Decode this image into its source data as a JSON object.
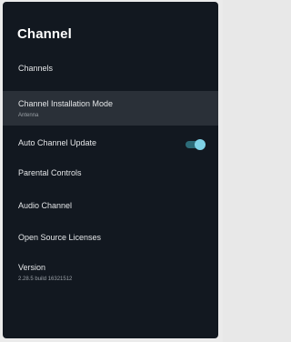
{
  "settings": {
    "title": "Channel",
    "items": [
      {
        "label": "Channels"
      },
      {
        "label": "Channel Installation Mode",
        "value": "Antenna"
      },
      {
        "label": "Auto Channel Update",
        "toggle_on": true
      },
      {
        "label": "Parental Controls"
      },
      {
        "label": "Audio Channel"
      },
      {
        "label": "Open Source Licenses"
      },
      {
        "label": "Version",
        "value": "2.28.5 build 16321512"
      }
    ]
  },
  "colors": {
    "panel_background": "#121820",
    "focused_row": "#2a3038",
    "toggle_accent": "#7fd2e6"
  }
}
